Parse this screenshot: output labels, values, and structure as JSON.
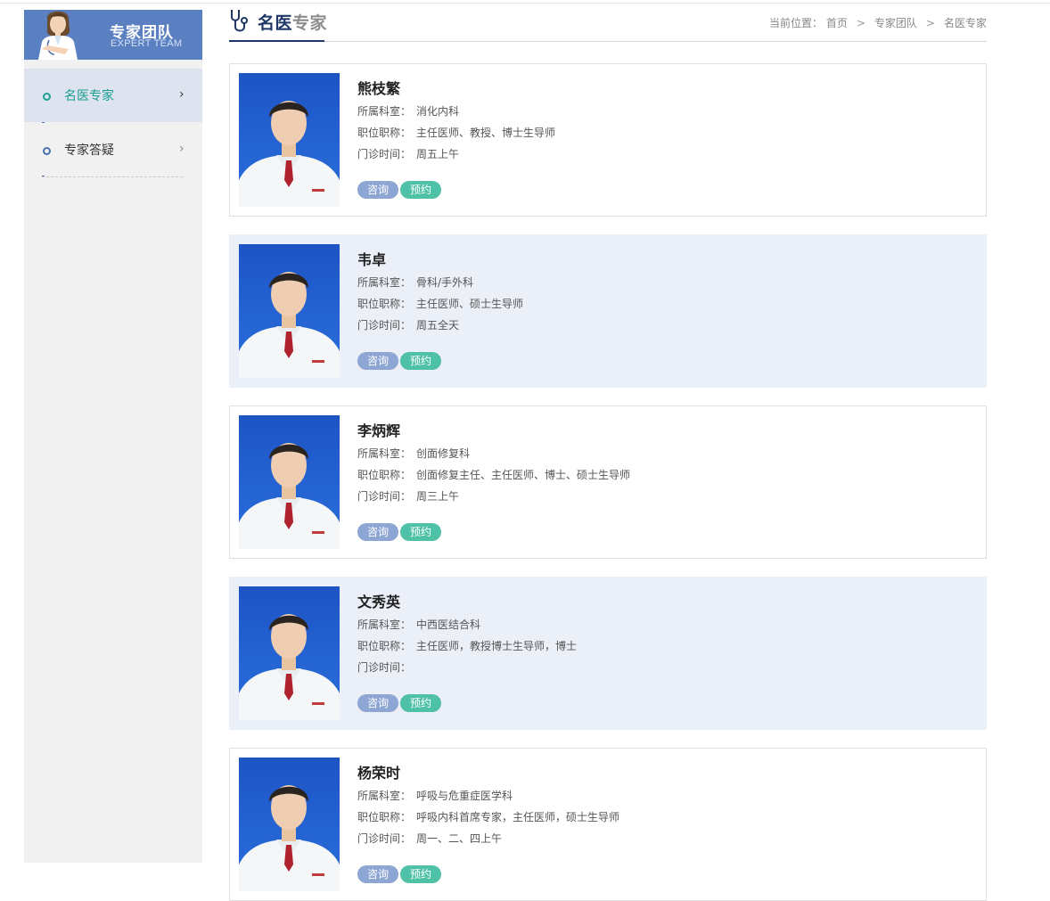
{
  "sidebar": {
    "title": "专家团队",
    "subtitle": "EXPERT TEAM",
    "items": [
      {
        "label": "名医专家",
        "active": true
      },
      {
        "label": "专家答疑",
        "active": false
      }
    ]
  },
  "header": {
    "title_a": "名医",
    "title_b": "专家",
    "breadcrumb": {
      "prefix": "当前位置：",
      "items": [
        "首页",
        "专家团队",
        "名医专家"
      ],
      "separator": ">"
    }
  },
  "labels": {
    "dept": "所属科室：",
    "title": "职位职称：",
    "clinic": "门诊时间：",
    "consult": "咨询",
    "book": "预约"
  },
  "doctors": [
    {
      "name": "熊枝繁",
      "dept": "消化内科",
      "title": "主任医师、教授、博士生导师",
      "clinic": "周五上午"
    },
    {
      "name": "韦卓",
      "dept": "骨科/手外科",
      "title": "主任医师、硕士生导师",
      "clinic": "周五全天"
    },
    {
      "name": "李炳辉",
      "dept": "创面修复科",
      "title": "创面修复主任、主任医师、博士、硕士生导师",
      "clinic": "周三上午"
    },
    {
      "name": "文秀英",
      "dept": "中西医结合科",
      "title": "主任医师，教授博士生导师，博士",
      "clinic": ""
    },
    {
      "name": "杨荣时",
      "dept": "呼吸与危重症医学科",
      "title": "呼吸内科首席专家，主任医师，硕士生导师",
      "clinic": "周一、二、四上午"
    }
  ],
  "colors": {
    "sidebar_header": "#5a80c2",
    "active_text": "#1a9d91",
    "consult_btn": "#8ea6d4",
    "book_btn": "#4fc1a7",
    "card_shade": "#ebeff8",
    "photo_bg": "#2060cc"
  }
}
